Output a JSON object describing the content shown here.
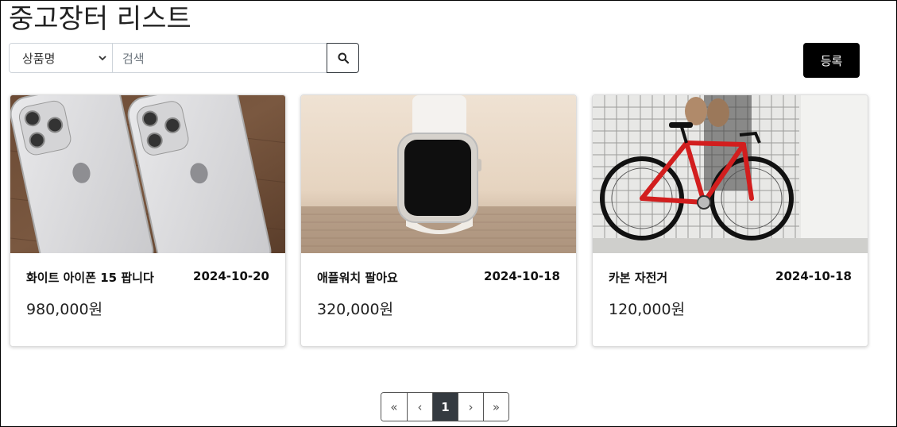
{
  "page": {
    "title": "중고장터 리스트"
  },
  "search": {
    "select_value": "상품명",
    "placeholder": "검색",
    "button_icon": "search-icon"
  },
  "register": {
    "label": "등록"
  },
  "products": [
    {
      "name": "화이트 아이폰 15 팝니다",
      "date": "2024-10-20",
      "price": "980,000원",
      "image": "iphone-photo"
    },
    {
      "name": "애플워치 팔아요",
      "date": "2024-10-18",
      "price": "320,000원",
      "image": "apple-watch-photo"
    },
    {
      "name": "카본 자전거",
      "date": "2024-10-18",
      "price": "120,000원",
      "image": "bicycle-photo"
    }
  ],
  "pagination": {
    "first": "«",
    "prev": "‹",
    "current": "1",
    "next": "›",
    "last": "»"
  }
}
